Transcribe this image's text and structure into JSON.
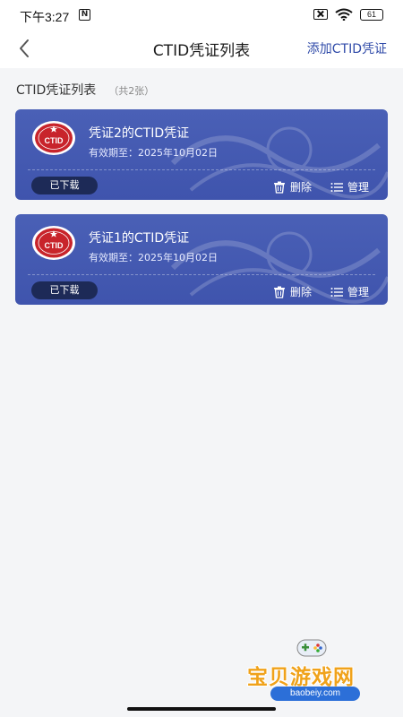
{
  "status_bar": {
    "time": "下午3:27",
    "n_badge": "N",
    "battery": "61"
  },
  "header": {
    "title": "CTID凭证列表",
    "add_label": "添加CTID凭证"
  },
  "section": {
    "title": "CTID凭证列表",
    "count": "（共2张）"
  },
  "cards": [
    {
      "title": "凭证2的CTID凭证",
      "valid": "有效期至：2025年10月02日",
      "badge": "已下载",
      "delete_label": "删除",
      "manage_label": "管理",
      "logo_text": "CTID"
    },
    {
      "title": "凭证1的CTID凭证",
      "valid": "有效期至：2025年10月02日",
      "badge": "已下载",
      "delete_label": "删除",
      "manage_label": "管理",
      "logo_text": "CTID"
    }
  ],
  "watermark": {
    "text": "宝贝游戏网",
    "url": "baobeiy.com"
  },
  "colors": {
    "card": "#4a60b6",
    "badge": "#1d2a57",
    "link": "#2f4aa8",
    "logo_red": "#c8242b"
  }
}
